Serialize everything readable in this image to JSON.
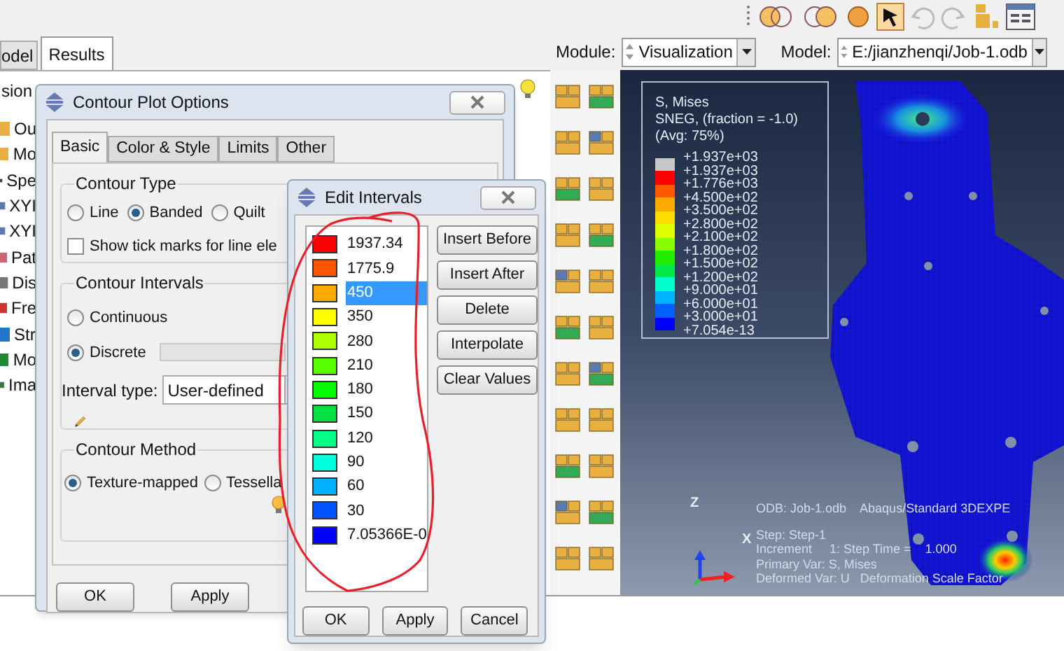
{
  "left_tabs": [
    {
      "label": "odel",
      "selected": false
    },
    {
      "label": "Results",
      "selected": true
    }
  ],
  "module": {
    "label": "Module:",
    "value": "Visualization"
  },
  "model": {
    "label": "Model:",
    "value": "E:/jianzhenqi/Job-1.odb"
  },
  "tree": {
    "header": "sion",
    "items": [
      "Ou",
      "Mo",
      "Spe",
      "XYI",
      "XYI",
      "Pat",
      "Dis",
      "Fre",
      "Str",
      "Mo",
      "Ima"
    ]
  },
  "viewport": {
    "legend": {
      "title_lines": [
        "S, Mises",
        "SNEG, (fraction = -1.0)",
        "(Avg: 75%)"
      ],
      "bands": [
        {
          "color": "#c8c8c8"
        },
        {
          "color": "#ff0000"
        },
        {
          "color": "#ff5a00"
        },
        {
          "color": "#ffaa00"
        },
        {
          "color": "#ffdd00"
        },
        {
          "color": "#ddff00"
        },
        {
          "color": "#88ff00"
        },
        {
          "color": "#22ee00"
        },
        {
          "color": "#00e84a"
        },
        {
          "color": "#00ffcc"
        },
        {
          "color": "#00b4ff"
        },
        {
          "color": "#0060ff"
        },
        {
          "color": "#0000ff"
        }
      ],
      "labels": [
        "+1.937e+03",
        "+1.937e+03",
        "+1.776e+03",
        "+4.500e+02",
        "+3.500e+02",
        "+2.800e+02",
        "+2.100e+02",
        "+1.800e+02",
        "+1.500e+02",
        "+1.200e+02",
        "+9.000e+01",
        "+6.000e+01",
        "+3.000e+01",
        "+7.054e-13"
      ]
    },
    "triad": {
      "z": "Z",
      "x": "X"
    },
    "info_lines": [
      "ODB: Job-1.odb    Abaqus/Standard 3DEXPE",
      "Step: Step-1",
      "Increment     1: Step Time =    1.000",
      "Primary Var: S, Mises",
      "Deformed Var: U   Deformation Scale Factor"
    ]
  },
  "contour_dialog": {
    "title": "Contour Plot Options",
    "tabs": [
      {
        "label": "Basic",
        "selected": true
      },
      {
        "label": "Color & Style",
        "selected": false
      },
      {
        "label": "Limits",
        "selected": false
      },
      {
        "label": "Other",
        "selected": false
      }
    ],
    "contour_type": {
      "title": "Contour Type",
      "options": [
        {
          "label": "Line",
          "selected": false
        },
        {
          "label": "Banded",
          "selected": true
        },
        {
          "label": "Quilt",
          "selected": false
        }
      ],
      "tick_marks": {
        "label": "Show tick marks for line ele",
        "checked": false
      }
    },
    "contour_intervals": {
      "title": "Contour Intervals",
      "options": [
        {
          "label": "Continuous",
          "selected": false
        },
        {
          "label": "Discrete",
          "selected": true
        }
      ],
      "interval_type": {
        "label": "Interval type:",
        "value": "User-defined"
      }
    },
    "contour_method": {
      "title": "Contour Method",
      "options": [
        {
          "label": "Texture-mapped",
          "selected": true
        },
        {
          "label": "Tessella",
          "selected": false
        }
      ]
    },
    "buttons": [
      "OK",
      "Apply"
    ]
  },
  "edit_intervals": {
    "title": "Edit Intervals",
    "intervals": [
      {
        "value": "1937.34",
        "color": "#ff0000",
        "selected": false
      },
      {
        "value": "1775.9",
        "color": "#ff5500",
        "selected": false
      },
      {
        "value": "450",
        "color": "#ffaa00",
        "selected": true
      },
      {
        "value": "350",
        "color": "#ffff00",
        "selected": false
      },
      {
        "value": "280",
        "color": "#aaff00",
        "selected": false
      },
      {
        "value": "210",
        "color": "#55ff00",
        "selected": false
      },
      {
        "value": "180",
        "color": "#00ff00",
        "selected": false
      },
      {
        "value": "150",
        "color": "#00e040",
        "selected": false
      },
      {
        "value": "120",
        "color": "#00ff88",
        "selected": false
      },
      {
        "value": "90",
        "color": "#00ffdd",
        "selected": false
      },
      {
        "value": "60",
        "color": "#00b0ff",
        "selected": false
      },
      {
        "value": "30",
        "color": "#0055ff",
        "selected": false
      },
      {
        "value": "7.05366E-0",
        "color": "#0000ff",
        "selected": false
      }
    ],
    "side_buttons": [
      "Insert Before",
      "Insert After",
      "Delete",
      "Interpolate",
      "Clear Values"
    ],
    "buttons": [
      "OK",
      "Apply",
      "Cancel"
    ]
  }
}
